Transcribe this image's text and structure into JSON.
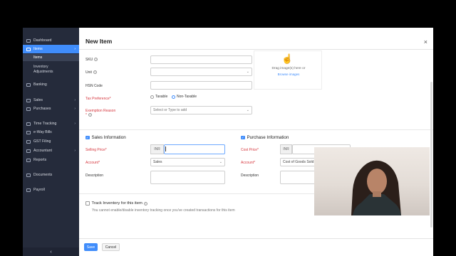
{
  "sidebar": {
    "items": [
      {
        "label": "Dashboard",
        "arrow": ""
      },
      {
        "label": "Items",
        "arrow": "›"
      },
      {
        "label": "Banking",
        "arrow": ""
      },
      {
        "label": "Sales",
        "arrow": "›"
      },
      {
        "label": "Purchases",
        "arrow": "›"
      },
      {
        "label": "Time Tracking",
        "arrow": "›"
      },
      {
        "label": "e-Way Bills",
        "arrow": ""
      },
      {
        "label": "GST Filing",
        "arrow": ""
      },
      {
        "label": "Accountant",
        "arrow": "›"
      },
      {
        "label": "Reports",
        "arrow": ""
      },
      {
        "label": "Documents",
        "arrow": ""
      },
      {
        "label": "Payroll",
        "arrow": ""
      }
    ],
    "subitems": [
      "Items",
      "Inventory Adjustments"
    ],
    "collapse_icon": "‹"
  },
  "header": {
    "title": "New Item",
    "close_icon": "×"
  },
  "form": {
    "sku_label": "SKU",
    "unit_label": "Unit",
    "hsn_label": "HSN Code",
    "tax_label": "Tax Preference*",
    "tax_options": [
      "Taxable",
      "Non-Taxable"
    ],
    "exemption_label": "Exemption Reason",
    "exemption_star": "*",
    "exemption_placeholder": "Select or Type to add",
    "image_drop_text": "Drag image(s) here or",
    "image_browse": "Browse images"
  },
  "sales": {
    "section_title": "Sales Information",
    "price_label": "Selling Price*",
    "currency": "INR",
    "account_label": "Account*",
    "account_value": "Sales",
    "description_label": "Description"
  },
  "purchase": {
    "section_title": "Purchase Information",
    "price_label": "Cost Price*",
    "currency": "INR",
    "account_label": "Account*",
    "account_value": "Cost of Goods Sold",
    "description_label": "Description"
  },
  "inventory": {
    "label": "Track Inventory for this item",
    "note": "You cannot enable/disable inventory tracking once you've created transactions for this item"
  },
  "footer": {
    "save": "Save",
    "cancel": "Cancel"
  },
  "colors": {
    "accent": "#408dfb",
    "sidebar": "#252b3b",
    "required": "#d6383f"
  }
}
